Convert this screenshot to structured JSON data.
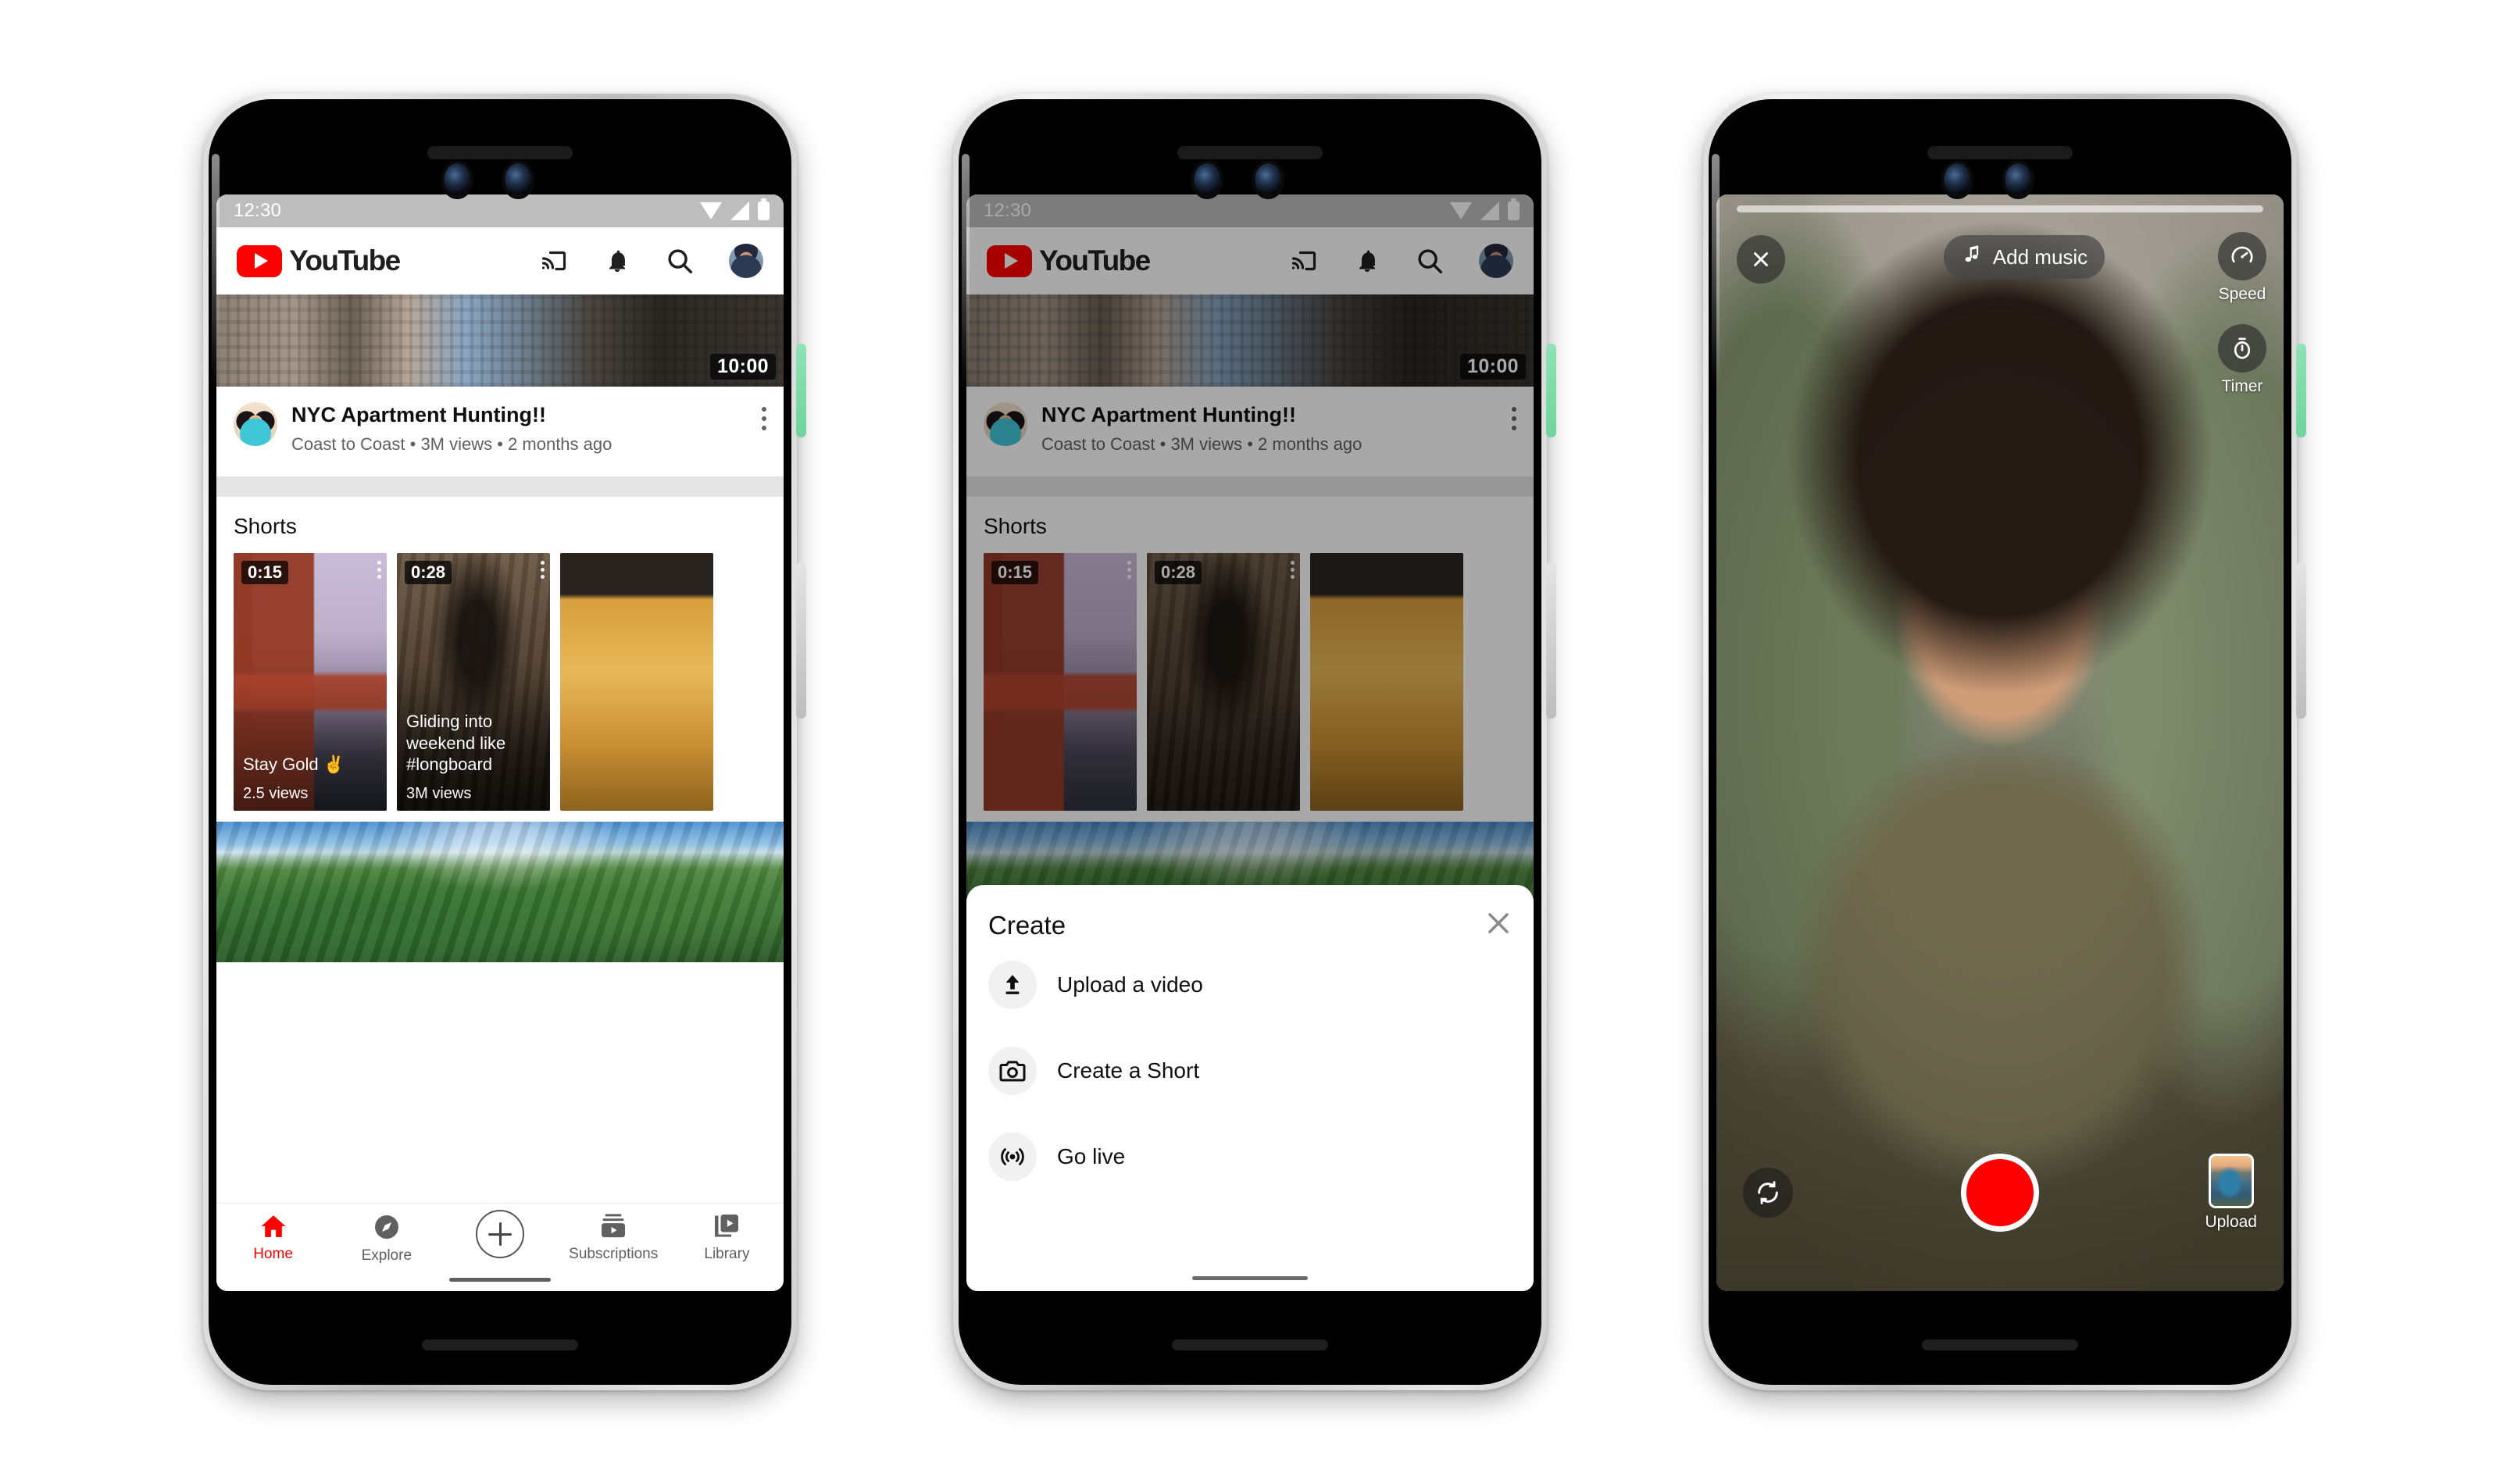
{
  "phones": [
    {
      "id": "phone-home",
      "status_bar": {
        "time": "12:30",
        "icons": [
          "wifi-icon",
          "signal-icon",
          "battery-icon"
        ]
      },
      "app_bar": {
        "brand": "YouTube",
        "actions": [
          "cast-icon",
          "notifications-bell-icon",
          "search-icon",
          "account-avatar"
        ]
      },
      "feed_video": {
        "duration": "10:00",
        "title": "NYC Apartment Hunting!!",
        "subtitle": "Coast to Coast • 3M views • 2 months ago"
      },
      "shorts": {
        "header": "Shorts",
        "items": [
          {
            "badge": "0:15",
            "title": "Stay Gold ✌️",
            "views": "2.5 views"
          },
          {
            "badge": "0:28",
            "title": "Gliding into weekend like #longboard",
            "views": "3M views"
          },
          {
            "badge": "",
            "title": "",
            "views": ""
          }
        ]
      },
      "tabbar": {
        "items": [
          {
            "label": "Home",
            "icon": "home-icon",
            "active": true
          },
          {
            "label": "Explore",
            "icon": "compass-icon",
            "active": false
          },
          {
            "label": "",
            "icon": "plus-create-icon",
            "active": false
          },
          {
            "label": "Subscriptions",
            "icon": "subscriptions-icon",
            "active": false
          },
          {
            "label": "Library",
            "icon": "library-icon",
            "active": false
          }
        ]
      }
    },
    {
      "id": "phone-create-sheet",
      "status_bar": {
        "time": "12:30"
      },
      "app_bar": {
        "brand": "YouTube"
      },
      "feed_video": {
        "duration": "10:00",
        "title": "NYC Apartment Hunting!!",
        "subtitle": "Coast to Coast • 3M views • 2 months ago"
      },
      "shorts": {
        "header": "Shorts",
        "items": [
          {
            "badge": "0:15"
          },
          {
            "badge": "0:28"
          },
          {
            "badge": ""
          }
        ]
      },
      "sheet": {
        "title": "Create",
        "close_icon": "close-icon",
        "items": [
          {
            "label": "Upload a video",
            "icon": "upload-icon"
          },
          {
            "label": "Create a Short",
            "icon": "camera-icon"
          },
          {
            "label": "Go live",
            "icon": "broadcast-icon"
          }
        ]
      }
    },
    {
      "id": "phone-shorts-camera",
      "camera": {
        "close_icon": "close-icon",
        "music_button": {
          "label": "Add music",
          "icon": "music-note-icon"
        },
        "tools": [
          {
            "label": "Speed",
            "icon": "speedometer-icon"
          },
          {
            "label": "Timer",
            "icon": "stopwatch-icon"
          }
        ],
        "flip_icon": "flip-camera-icon",
        "record_button": "record-button",
        "upload": {
          "label": "Upload",
          "icon": "gallery-thumbnail"
        }
      }
    }
  ],
  "colors": {
    "youtube_red": "#ff0000",
    "text_primary": "#0f0f0f",
    "text_secondary": "#606060",
    "status_bar_gray": "#bdbdbd",
    "sheet_icon_bg": "#f1f1f1",
    "power_button_green": "#8fe2b4"
  }
}
